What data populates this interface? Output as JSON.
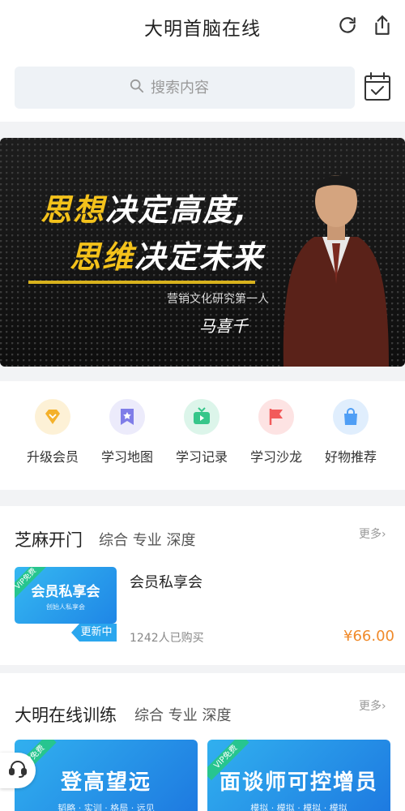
{
  "header": {
    "title": "大明首脑在线"
  },
  "search": {
    "placeholder": "搜索内容"
  },
  "banner": {
    "line1_yellow": "思想",
    "line1_white": "决定高度,",
    "line2_yellow": "思维",
    "line2_white": "决定未来",
    "subtitle": "营销文化研究第一人",
    "signature": "马喜千"
  },
  "quicknav": [
    {
      "label": "升级会员",
      "icon": "diamond-icon",
      "color": "#f4b12a"
    },
    {
      "label": "学习地图",
      "icon": "map-star-icon",
      "color": "#7f7de8"
    },
    {
      "label": "学习记录",
      "icon": "tv-record-icon",
      "color": "#36c68a"
    },
    {
      "label": "学习沙龙",
      "icon": "flag-icon",
      "color": "#f25a5a"
    },
    {
      "label": "好物推荐",
      "icon": "shopping-bag-icon",
      "color": "#4f9ef5"
    }
  ],
  "section1": {
    "title": "芝麻开门",
    "tags": "综合 专业 深度",
    "more": "更多",
    "course": {
      "thumb_title": "会员私享会",
      "thumb_sub": "创始人私享会",
      "vip_badge": "VIP免费",
      "update_tag": "更新中",
      "name": "会员私享会",
      "buyers": "1242人已购买",
      "price": "¥66.00"
    }
  },
  "section2": {
    "title": "大明在线训练",
    "tags": "综合 专业 深度",
    "more": "更多",
    "cards": [
      {
        "title": "登高望远",
        "sub": "韬略 · 实训 · 格局 · 远见",
        "vip_badge": "VIP免费"
      },
      {
        "title": "面谈师可控增员",
        "sub": "模拟 · 模拟 · 模拟 · 模拟",
        "vip_badge": "VIP免费"
      }
    ]
  },
  "colors": {
    "accent_blue": "#2aa6ee",
    "price_orange": "#f08a2a",
    "banner_yellow": "#f4c21b"
  }
}
